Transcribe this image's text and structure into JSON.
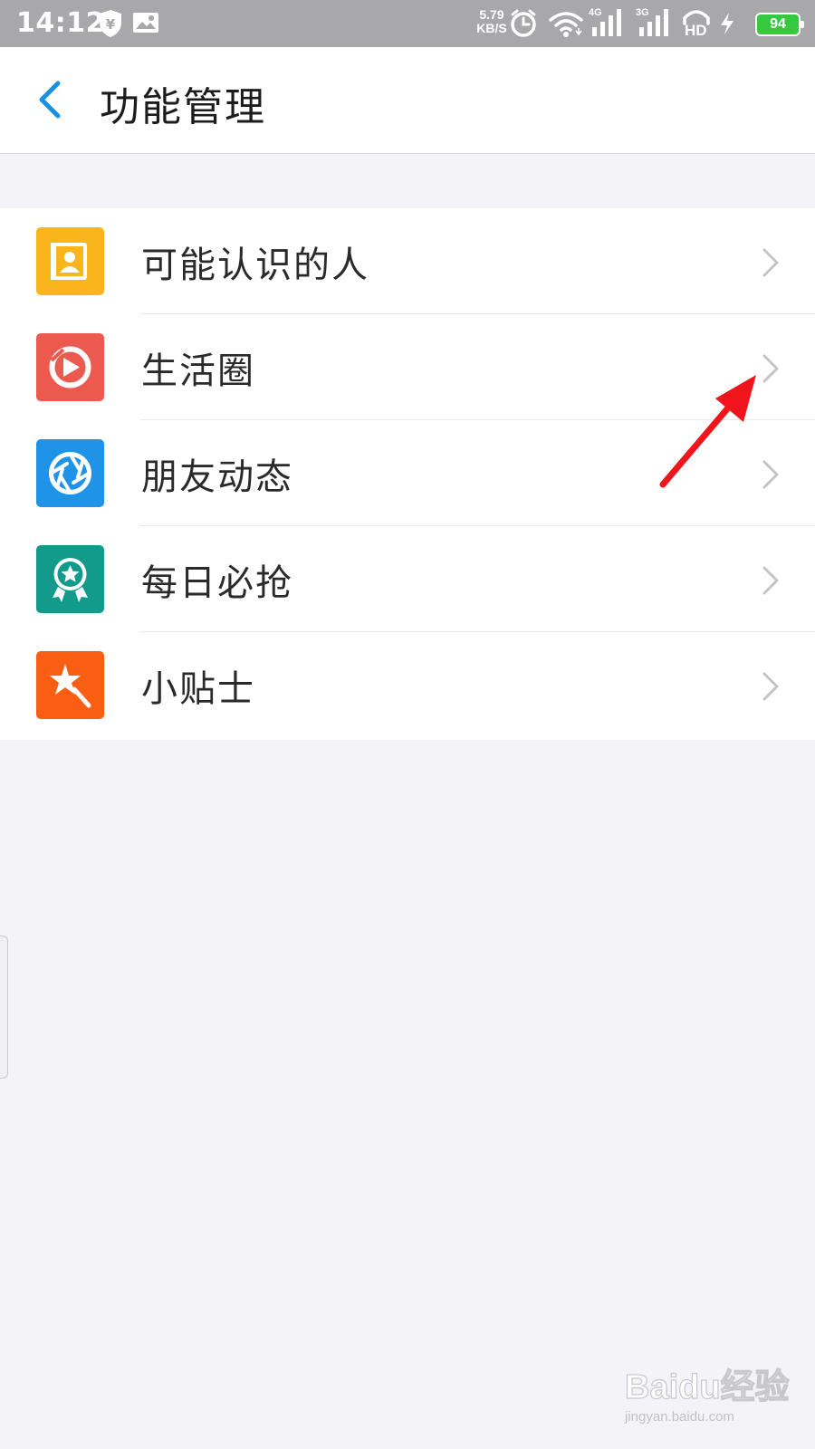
{
  "status_bar": {
    "time": "14:12",
    "net_speed_value": "5.79",
    "net_speed_unit": "KB/S",
    "signal_1_label": "4G",
    "signal_2_label": "3G",
    "hd_label": "HD",
    "battery": "94",
    "icons": [
      "shield-yuan-icon",
      "image-notification-icon",
      "alarm-icon",
      "wifi-icon",
      "signal-icon",
      "hd-voice-icon",
      "charging-icon",
      "battery-icon"
    ]
  },
  "header": {
    "back_icon": "chevron-left-icon",
    "title": "功能管理"
  },
  "colors": {
    "accent_blue": "#1a8fe3",
    "annotation_red": "#f0141c",
    "contacts_icon_bg": "#f9b51b",
    "life_circle_icon_bg": "#ec5a4f",
    "friends_feed_icon_bg": "#1f93e8",
    "daily_deal_icon_bg": "#129a8b",
    "tips_icon_bg": "#fa5e12"
  },
  "list": {
    "items": [
      {
        "label": "可能认识的人",
        "icon": "contact-card-icon"
      },
      {
        "label": "生活圈",
        "icon": "play-circle-icon"
      },
      {
        "label": "朋友动态",
        "icon": "aperture-icon"
      },
      {
        "label": "每日必抢",
        "icon": "star-medal-icon"
      },
      {
        "label": "小贴士",
        "icon": "magic-wand-icon"
      }
    ]
  },
  "watermark": {
    "brand": "Baidu经验",
    "url": "jingyan.baidu.com"
  }
}
